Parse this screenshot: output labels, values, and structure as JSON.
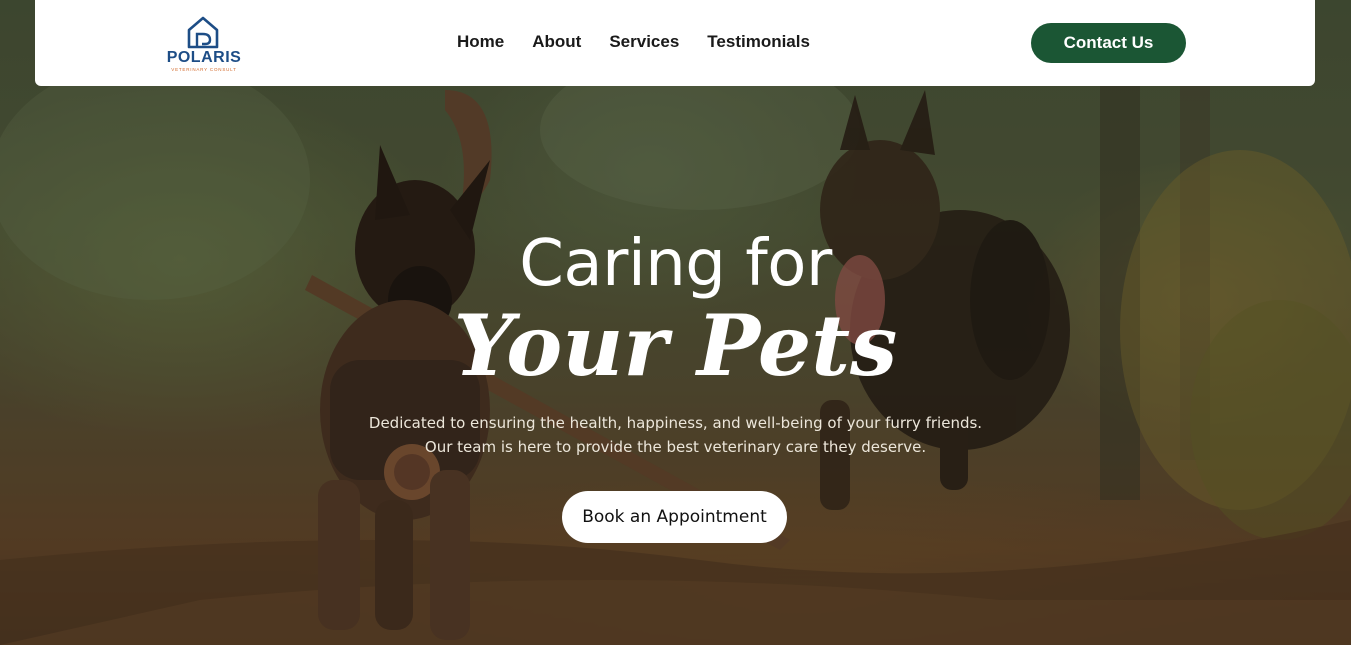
{
  "brand": {
    "name": "POLARIS",
    "tagline": "VETERINARY CONSULT",
    "logo_icon": "house-paw-icon",
    "primary_color": "#1b5634",
    "logo_color": "#1d4d86",
    "logo_accent": "#d2692a"
  },
  "nav": {
    "items": [
      {
        "label": "Home"
      },
      {
        "label": "About"
      },
      {
        "label": "Services"
      },
      {
        "label": "Testimonials"
      }
    ],
    "contact_label": "Contact Us"
  },
  "hero": {
    "title_line1": "Caring for",
    "title_line2": "Your Pets",
    "subtitle_line1": "Dedicated to ensuring the health, happiness, and well-being of your furry friends.",
    "subtitle_line2": "Our team is here to provide the best veterinary care they deserve.",
    "cta_label": "Book an Appointment",
    "background_image": "two-dogs-running-in-forest-photo"
  }
}
